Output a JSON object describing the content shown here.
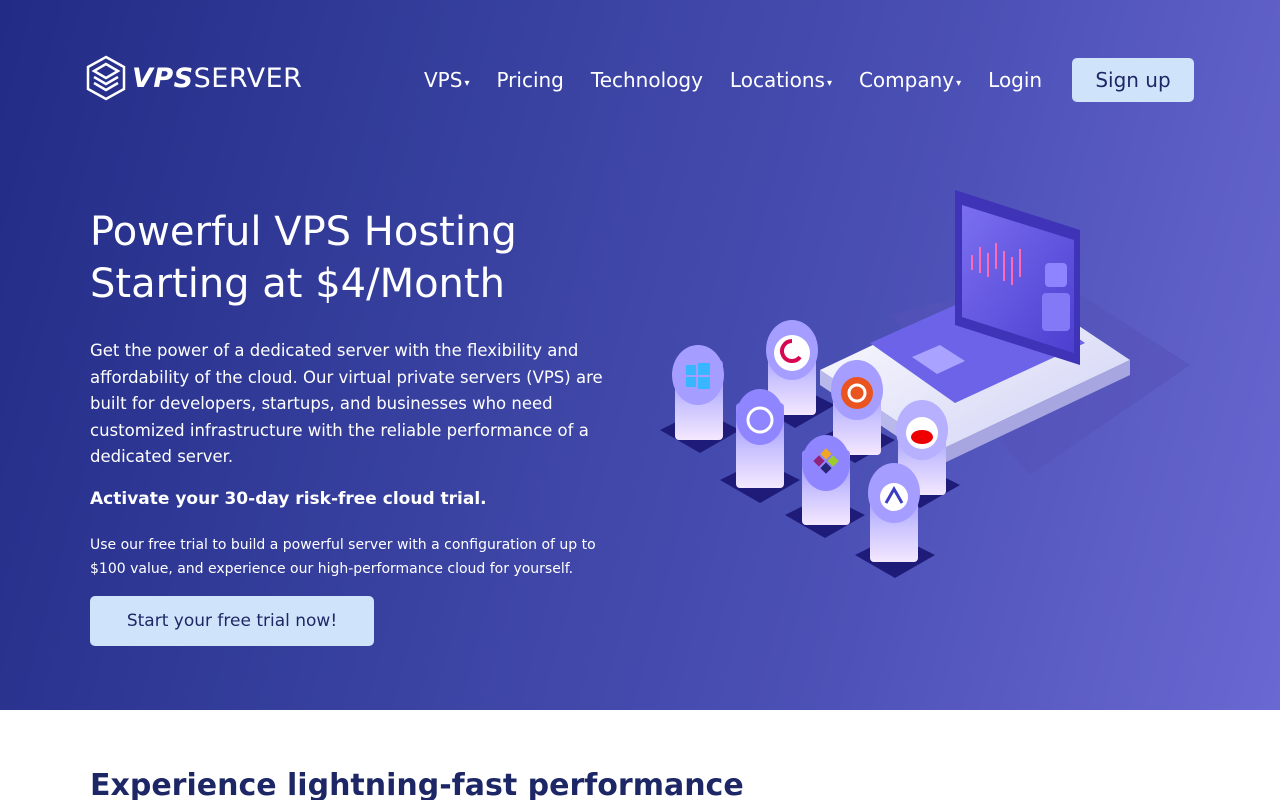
{
  "header": {
    "logo": {
      "bold_text": "VPS",
      "light_text": "SERVER"
    },
    "nav": [
      {
        "label": "VPS",
        "has_dropdown": true
      },
      {
        "label": "Pricing",
        "has_dropdown": false
      },
      {
        "label": "Technology",
        "has_dropdown": false
      },
      {
        "label": "Locations",
        "has_dropdown": true
      },
      {
        "label": "Company",
        "has_dropdown": true
      },
      {
        "label": "Login",
        "has_dropdown": false
      }
    ],
    "signup_label": "Sign up",
    "caret_glyph": "▾"
  },
  "hero": {
    "title": "Powerful VPS Hosting Starting at $4/Month",
    "description": "Get the power of a dedicated server with the flexibility and affordability of the cloud. Our virtual private servers (VPS) are built for developers, startups, and businesses who need customized infrastructure with the reliable performance of a dedicated server.",
    "cta_title": "Activate your 30-day risk-free cloud trial.",
    "note": "Use our free trial to build a powerful server with a configuration of up to $100 value, and experience our high-performance cloud for yourself.",
    "trial_button": "Start your free trial now!",
    "illustration_icons": [
      "windows-icon",
      "debian-icon",
      "ubuntu-icon",
      "freebsd-icon",
      "redhat-icon",
      "centos-icon",
      "almalinux-icon"
    ]
  },
  "section": {
    "heading": "Experience lightning-fast performance"
  },
  "colors": {
    "hero_gradient_start": "#222c86",
    "hero_gradient_end": "#6a68d2",
    "button_bg": "#cfe4fb",
    "button_text": "#1e2766",
    "heading_dark": "#1e2766"
  }
}
